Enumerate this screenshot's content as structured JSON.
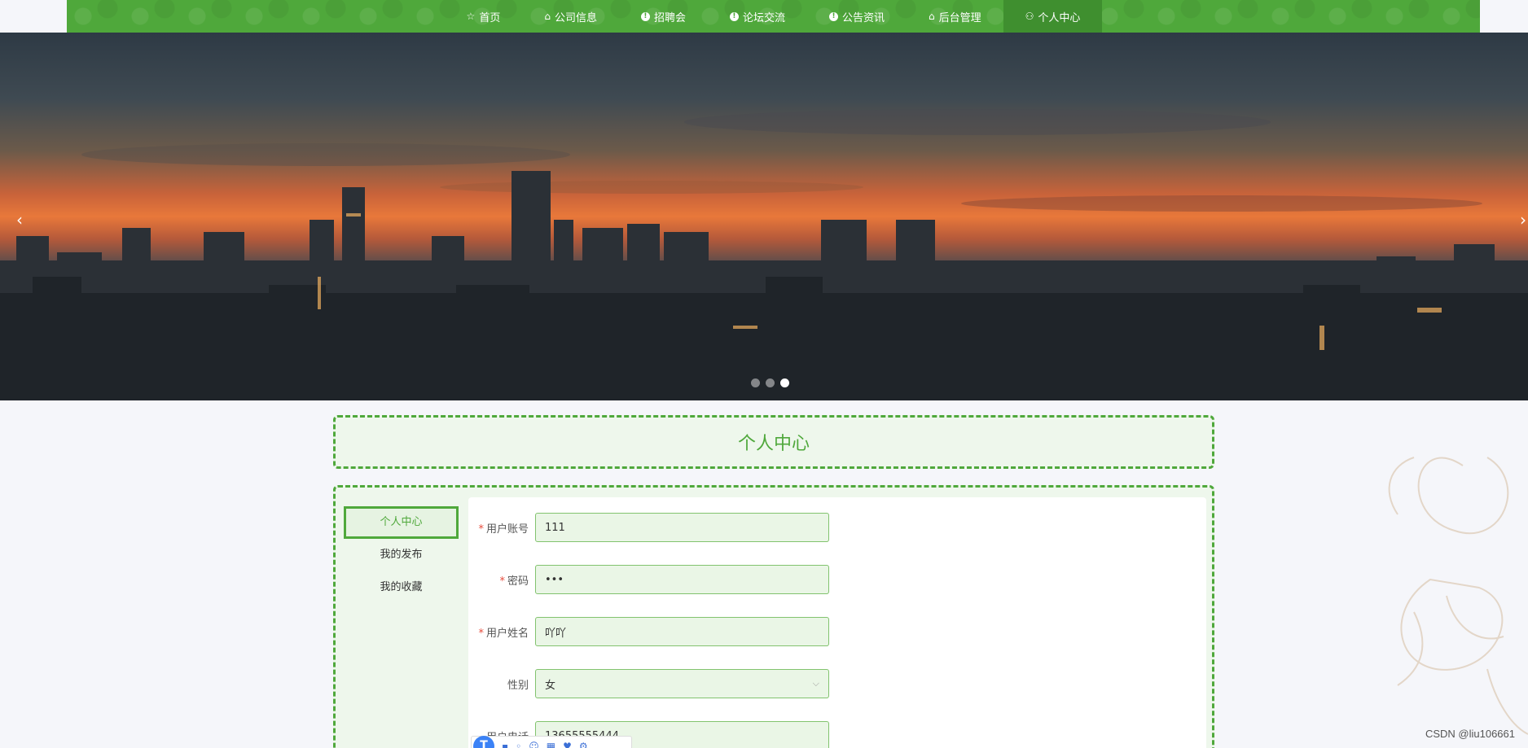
{
  "nav": {
    "items": [
      {
        "label": "首页",
        "icon": "star-icon",
        "glyph": "☆"
      },
      {
        "label": "公司信息",
        "icon": "bag-icon",
        "glyph": "⌂"
      },
      {
        "label": "招聘会",
        "icon": "info-icon",
        "glyph": "!"
      },
      {
        "label": "论坛交流",
        "icon": "info-icon",
        "glyph": "!"
      },
      {
        "label": "公告资讯",
        "icon": "info-icon",
        "glyph": "!"
      },
      {
        "label": "后台管理",
        "icon": "gift-icon",
        "glyph": "⌂"
      },
      {
        "label": "个人中心",
        "icon": "user-icon",
        "glyph": "⚇"
      }
    ],
    "active_index": 6
  },
  "banner": {
    "prev_glyph": "‹",
    "next_glyph": "›",
    "dot_count": 3,
    "active_dot": 2
  },
  "page_title": "个人中心",
  "side_menu": {
    "items": [
      "个人中心",
      "我的发布",
      "我的收藏"
    ],
    "active_index": 0
  },
  "form": {
    "account": {
      "label": "用户账号",
      "value": "111",
      "required": true
    },
    "password": {
      "label": "密码",
      "value": "•••",
      "required": true
    },
    "name": {
      "label": "用户姓名",
      "value": "吖吖",
      "required": true
    },
    "gender": {
      "label": "性别",
      "value": "女",
      "required": false
    },
    "phone": {
      "label": "用户电话",
      "value": "13655555444",
      "required": false
    }
  },
  "required_mark": "*",
  "float_bar": {
    "logo": "T"
  },
  "watermark": "CSDN @liu106661",
  "colors": {
    "brand_green": "#4fa83b",
    "active_nav": "#3f8f2f",
    "required": "#e74c3c"
  }
}
